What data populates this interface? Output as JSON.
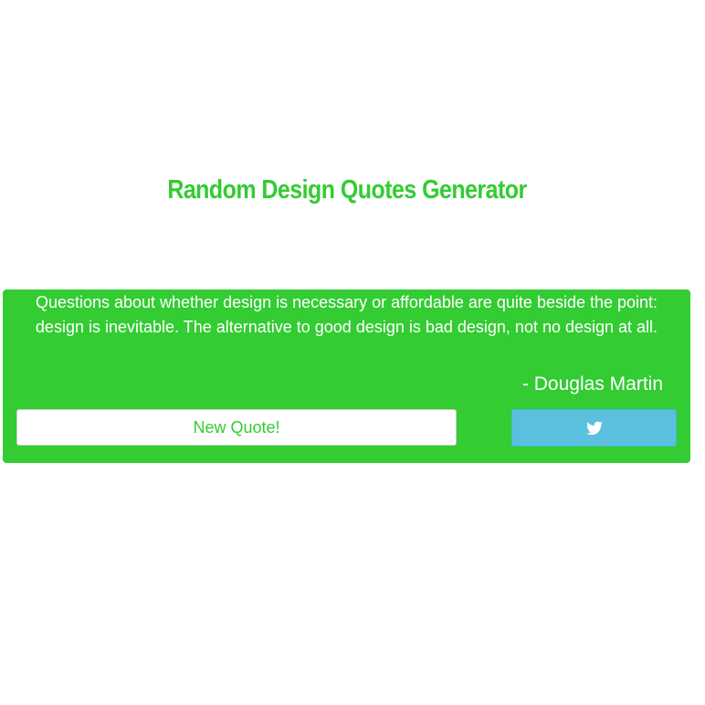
{
  "page": {
    "title": "Random Design Quotes Generator"
  },
  "quote": {
    "text": "Questions about whether design is necessary or affordable are quite beside the point: design is inevitable. The alternative to good design is bad design, not no design at all.",
    "author": "- Douglas Martin"
  },
  "buttons": {
    "new_quote_label": "New Quote!",
    "tweet_icon": "twitter-icon"
  },
  "colors": {
    "accent": "#33cc33",
    "tweet_button": "#5bc0de",
    "background": "#ffffff"
  }
}
